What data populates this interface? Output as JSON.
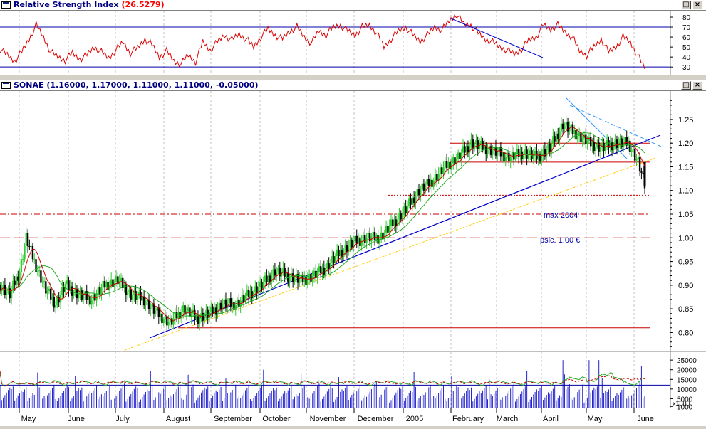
{
  "rsi_pane": {
    "title": "Relative Strength Index",
    "value": "(26.5279)",
    "restore_label": "□",
    "close_label": "×"
  },
  "price_pane": {
    "title": "SONAE",
    "ohlc": "(1.16000, 1.17000, 1.11000, 1.11000, -0.05000)",
    "restore_label": "□",
    "close_label": "×",
    "annotations": {
      "max_2004": "max 2004",
      "psic": "psic. 1.00 €"
    }
  },
  "volume_pane": {
    "multiplier_label": "x1000"
  },
  "colors": {
    "background": "#ffffff",
    "up_bar": "#33cc33",
    "down_bar": "#000000",
    "rsi_line": "#dd0000",
    "trendline": "#0000cc",
    "support_line": "#cc0000",
    "ma_fast": "#cc0000",
    "ma_slow": "#22aa22",
    "volume_bar": "#2222cc",
    "volume_ma1": "#22aa22",
    "volume_ma2": "#cc0000"
  },
  "chart_data": [
    {
      "type": "line",
      "name": "Relative Strength Index",
      "y_ticks": [
        30,
        40,
        50,
        60,
        70,
        80
      ],
      "ylim": [
        23,
        85
      ],
      "reference_lines": [
        30,
        70
      ],
      "x_index_range": [
        0,
        287
      ],
      "points": [
        [
          0,
          48
        ],
        [
          4,
          42
        ],
        [
          8,
          36
        ],
        [
          12,
          45
        ],
        [
          16,
          58
        ],
        [
          20,
          72
        ],
        [
          24,
          60
        ],
        [
          28,
          45
        ],
        [
          32,
          40
        ],
        [
          36,
          37
        ],
        [
          40,
          44
        ],
        [
          44,
          38
        ],
        [
          48,
          42
        ],
        [
          52,
          50
        ],
        [
          56,
          45
        ],
        [
          60,
          39
        ],
        [
          64,
          47
        ],
        [
          68,
          55
        ],
        [
          72,
          44
        ],
        [
          76,
          49
        ],
        [
          80,
          58
        ],
        [
          84,
          52
        ],
        [
          88,
          40
        ],
        [
          92,
          46
        ],
        [
          96,
          36
        ],
        [
          100,
          33
        ],
        [
          104,
          42
        ],
        [
          108,
          35
        ],
        [
          112,
          55
        ],
        [
          116,
          47
        ],
        [
          120,
          55
        ],
        [
          124,
          62
        ],
        [
          128,
          57
        ],
        [
          132,
          63
        ],
        [
          136,
          58
        ],
        [
          140,
          50
        ],
        [
          144,
          60
        ],
        [
          148,
          68
        ],
        [
          152,
          62
        ],
        [
          156,
          58
        ],
        [
          160,
          66
        ],
        [
          164,
          70
        ],
        [
          168,
          60
        ],
        [
          172,
          54
        ],
        [
          176,
          66
        ],
        [
          180,
          62
        ],
        [
          184,
          70
        ],
        [
          188,
          72
        ],
        [
          192,
          66
        ],
        [
          196,
          62
        ],
        [
          200,
          70
        ],
        [
          204,
          72
        ],
        [
          208,
          64
        ],
        [
          212,
          50
        ],
        [
          216,
          58
        ],
        [
          220,
          66
        ],
        [
          224,
          70
        ],
        [
          228,
          62
        ],
        [
          232,
          56
        ],
        [
          236,
          62
        ],
        [
          240,
          70
        ],
        [
          244,
          67
        ],
        [
          248,
          76
        ],
        [
          252,
          83
        ],
        [
          256,
          73
        ],
        [
          260,
          72
        ],
        [
          264,
          64
        ],
        [
          268,
          58
        ],
        [
          272,
          55
        ],
        [
          276,
          50
        ],
        [
          280,
          47
        ],
        [
          284,
          43
        ],
        [
          288,
          48
        ],
        [
          292,
          57
        ],
        [
          296,
          60
        ],
        [
          300,
          72
        ],
        [
          304,
          68
        ],
        [
          308,
          72
        ],
        [
          312,
          65
        ],
        [
          316,
          60
        ],
        [
          320,
          46
        ],
        [
          324,
          42
        ],
        [
          328,
          50
        ],
        [
          332,
          58
        ],
        [
          336,
          45
        ],
        [
          340,
          50
        ],
        [
          344,
          60
        ],
        [
          348,
          55
        ],
        [
          352,
          42
        ],
        [
          356,
          28
        ]
      ]
    },
    {
      "type": "bar",
      "name": "SONAE",
      "y_ticks": [
        0.8,
        0.85,
        0.9,
        0.95,
        1.0,
        1.05,
        1.1,
        1.15,
        1.2,
        1.25
      ],
      "ylim": [
        0.76,
        1.31
      ],
      "x_months": [
        "May",
        "June",
        "July",
        "August",
        "September",
        "October",
        "November",
        "December",
        "2005",
        "February",
        "March",
        "April",
        "May",
        "June"
      ],
      "close_path": [
        [
          0,
          0.9
        ],
        [
          6,
          0.88
        ],
        [
          12,
          0.93
        ],
        [
          16,
          1.0
        ],
        [
          22,
          0.94
        ],
        [
          28,
          0.89
        ],
        [
          34,
          0.86
        ],
        [
          40,
          0.9
        ],
        [
          48,
          0.88
        ],
        [
          56,
          0.87
        ],
        [
          64,
          0.9
        ],
        [
          72,
          0.91
        ],
        [
          80,
          0.88
        ],
        [
          88,
          0.87
        ],
        [
          96,
          0.84
        ],
        [
          104,
          0.82
        ],
        [
          112,
          0.85
        ],
        [
          120,
          0.83
        ],
        [
          128,
          0.84
        ],
        [
          136,
          0.86
        ],
        [
          144,
          0.86
        ],
        [
          152,
          0.88
        ],
        [
          160,
          0.9
        ],
        [
          168,
          0.93
        ],
        [
          176,
          0.92
        ],
        [
          184,
          0.91
        ],
        [
          192,
          0.92
        ],
        [
          200,
          0.94
        ],
        [
          208,
          0.97
        ],
        [
          216,
          0.99
        ],
        [
          224,
          1.0
        ],
        [
          232,
          1.0
        ],
        [
          240,
          1.03
        ],
        [
          248,
          1.06
        ],
        [
          256,
          1.1
        ],
        [
          264,
          1.12
        ],
        [
          272,
          1.15
        ],
        [
          280,
          1.17
        ],
        [
          288,
          1.2
        ],
        [
          296,
          1.19
        ],
        [
          304,
          1.18
        ],
        [
          312,
          1.17
        ],
        [
          320,
          1.18
        ],
        [
          328,
          1.17
        ],
        [
          336,
          1.19
        ],
        [
          344,
          1.24
        ],
        [
          352,
          1.22
        ],
        [
          360,
          1.2
        ],
        [
          368,
          1.19
        ],
        [
          376,
          1.2
        ],
        [
          384,
          1.2
        ],
        [
          390,
          1.16
        ],
        [
          394,
          1.11
        ]
      ],
      "horizontal_levels": [
        {
          "y": 1.2,
          "style": "solid",
          "color": "#cc0000"
        },
        {
          "y": 1.16,
          "style": "solid",
          "color": "#cc0000"
        },
        {
          "y": 1.09,
          "style": "dotted",
          "color": "#cc0000"
        },
        {
          "y": 1.05,
          "style": "dash-dot",
          "color": "#cc0000",
          "label": "max 2004"
        },
        {
          "y": 1.0,
          "style": "dashed",
          "color": "#cc0000",
          "label": "psic. 1.00 €"
        },
        {
          "y": 0.81,
          "style": "solid",
          "color": "#cc0000"
        }
      ],
      "last_close": 1.11
    },
    {
      "type": "bar",
      "name": "Volume",
      "y_ticks": [
        1000,
        5000,
        10000,
        15000,
        20000,
        25000
      ],
      "ylim": [
        0,
        28000
      ],
      "reference_line": 12000,
      "unit_label": "x1000"
    }
  ]
}
